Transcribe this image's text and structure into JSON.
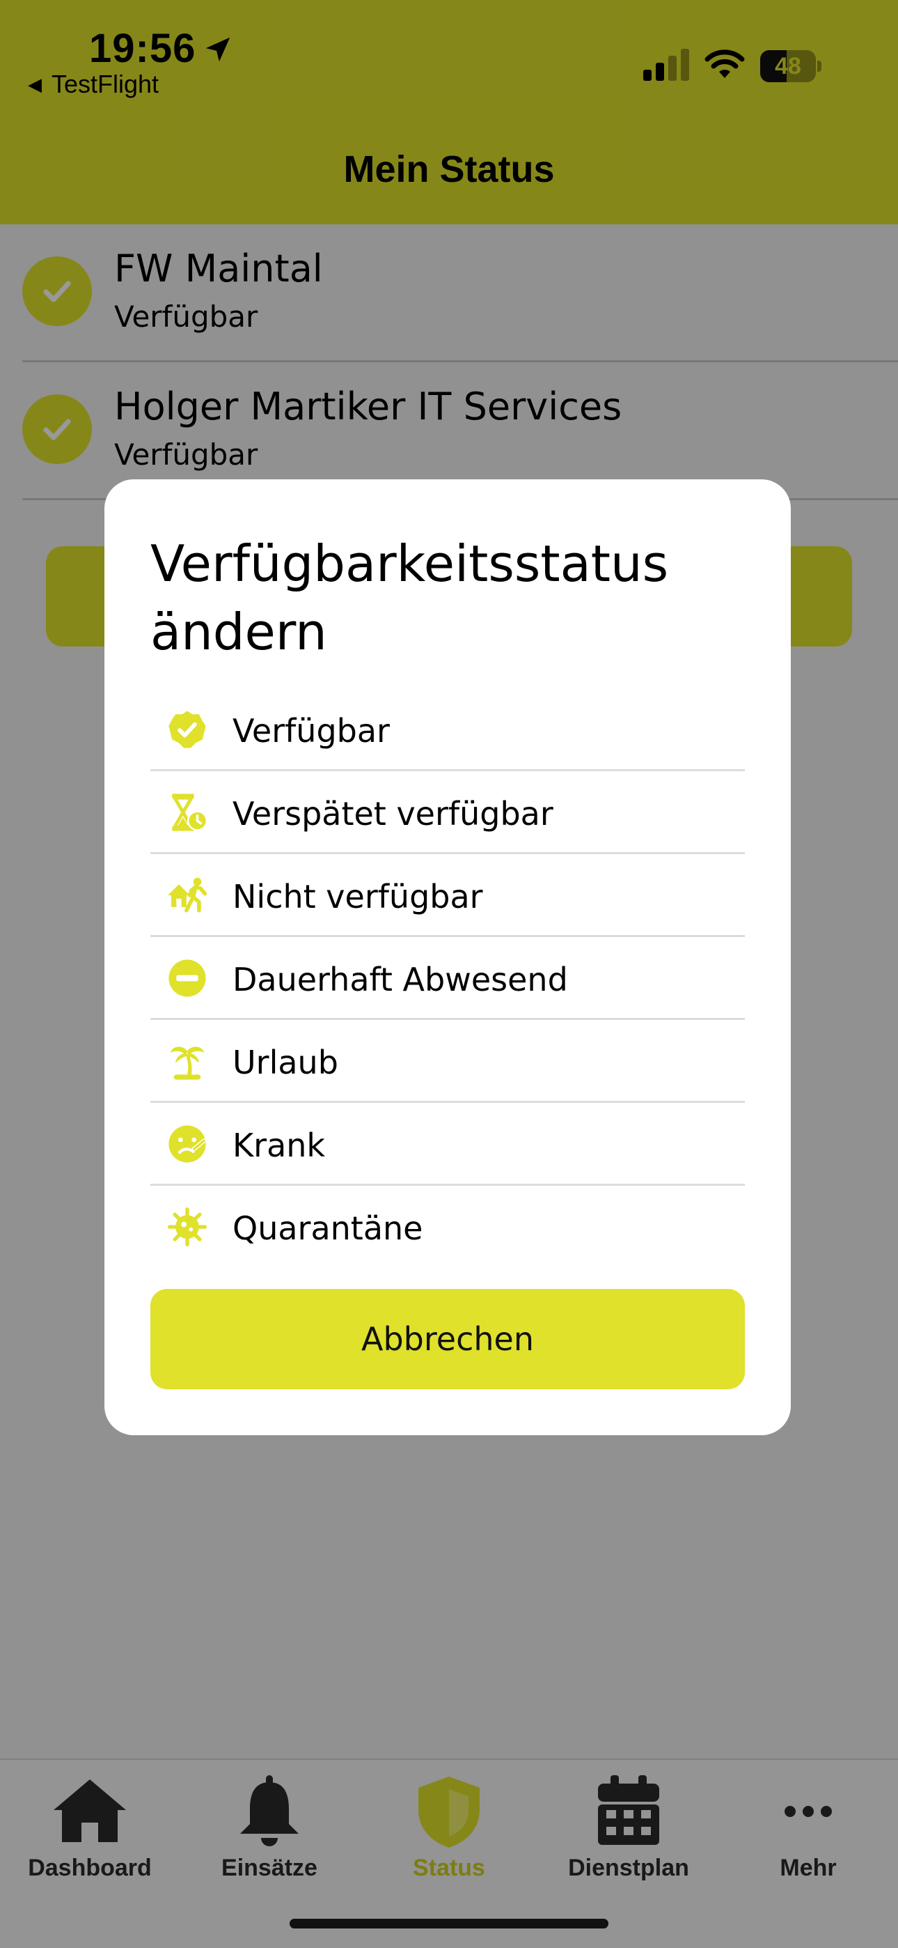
{
  "status_bar": {
    "time": "19:56",
    "back_app": "TestFlight",
    "battery_percent": "48",
    "battery_level": 0.48
  },
  "header": {
    "title": "Mein Status"
  },
  "orgs": [
    {
      "name": "FW Maintal",
      "status": "Verfügbar"
    },
    {
      "name": "Holger Martiker IT Services",
      "status": "Verfügbar"
    }
  ],
  "modal": {
    "title": "Verfügbarkeitsstatus ändern",
    "options": [
      {
        "label": "Verfügbar",
        "icon": "check-badge-icon"
      },
      {
        "label": "Verspätet verfügbar",
        "icon": "hourglass-clock-icon"
      },
      {
        "label": "Nicht verfügbar",
        "icon": "person-leaving-house-icon"
      },
      {
        "label": "Dauerhaft Abwesend",
        "icon": "minus-circle-icon"
      },
      {
        "label": "Urlaub",
        "icon": "palm-tree-icon"
      },
      {
        "label": "Krank",
        "icon": "sick-face-icon"
      },
      {
        "label": "Quarantäne",
        "icon": "virus-icon"
      }
    ],
    "cancel_label": "Abbrechen"
  },
  "tabbar": {
    "tabs": [
      {
        "label": "Dashboard",
        "icon": "home-icon",
        "active": false
      },
      {
        "label": "Einsätze",
        "icon": "bell-icon",
        "active": false
      },
      {
        "label": "Status",
        "icon": "shield-icon",
        "active": true
      },
      {
        "label": "Dienstplan",
        "icon": "calendar-icon",
        "active": false
      },
      {
        "label": "Mehr",
        "icon": "more-dots-icon",
        "active": false
      }
    ]
  },
  "colors": {
    "accent": "#dfe12b",
    "active_tab": "#cfd11e",
    "overlay": "rgba(0,0,0,0.40)"
  }
}
